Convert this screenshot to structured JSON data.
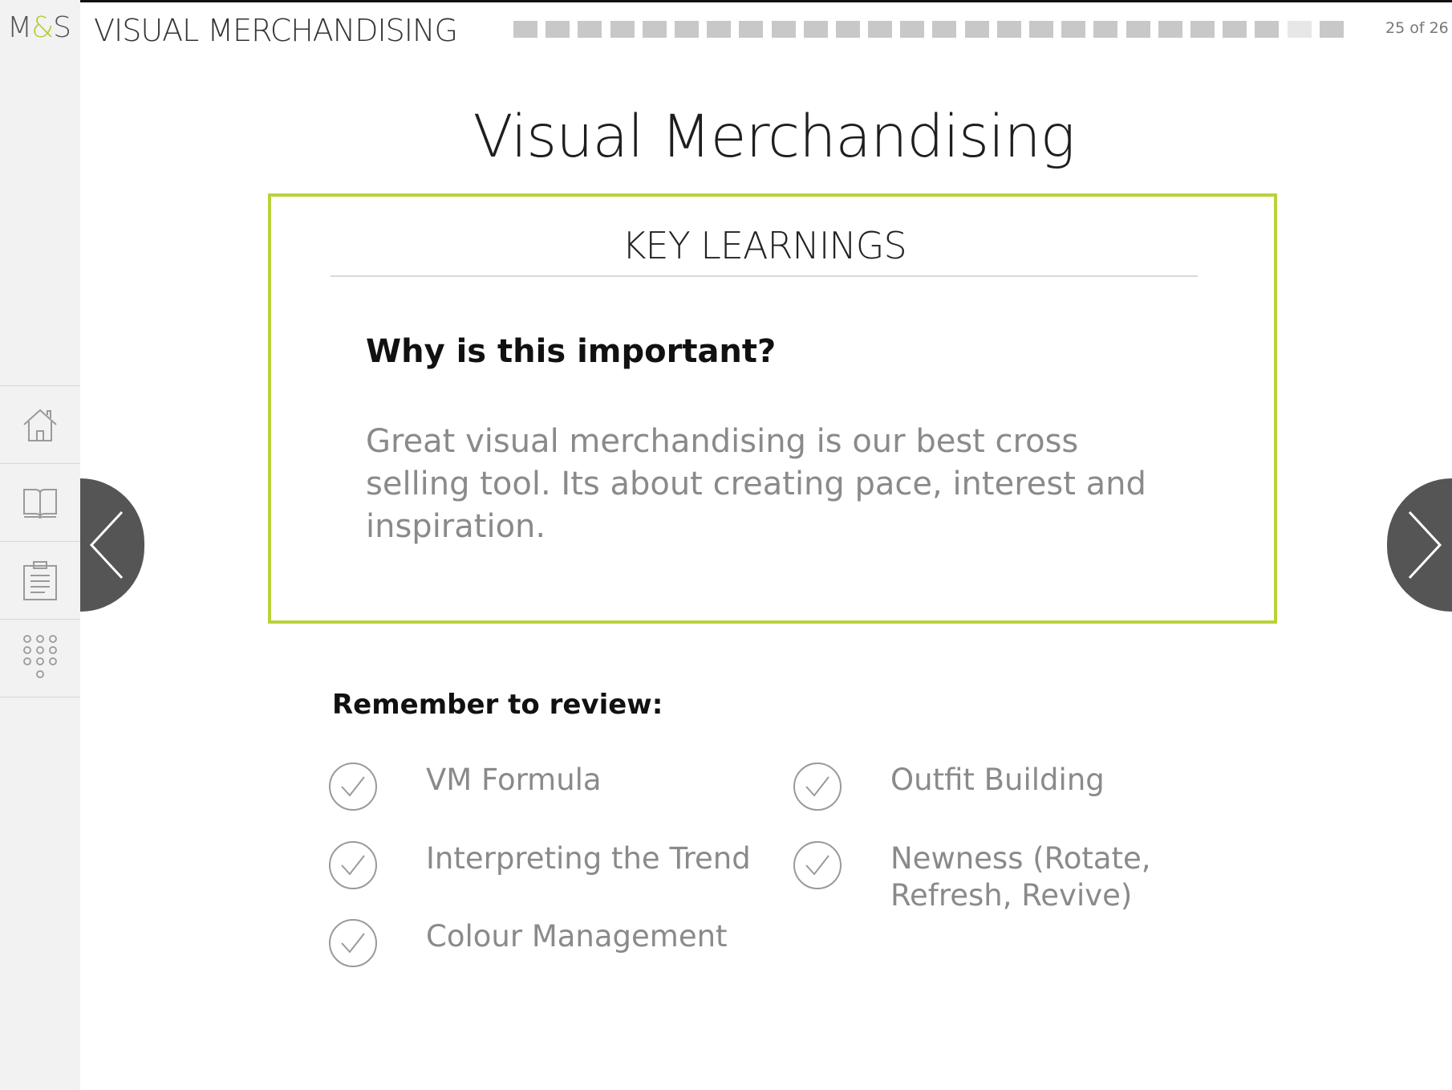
{
  "header": {
    "logo_left": "M",
    "logo_amp": "&",
    "logo_right": "S",
    "app_title": "VISUAL MERCHANDISING",
    "page_count": "25 of 26",
    "progress": {
      "current": 25,
      "total": 26
    }
  },
  "sidebar": {
    "items": [
      {
        "icon": "home-icon"
      },
      {
        "icon": "book-icon"
      },
      {
        "icon": "clipboard-icon"
      },
      {
        "icon": "grid-icon"
      }
    ]
  },
  "main": {
    "title": "Visual Merchandising",
    "key_box": {
      "heading": "KEY LEARNINGS",
      "question": "Why is this important?",
      "text": "Great visual merchandising is our best cross selling tool. Its about creating pace, interest and inspiration."
    },
    "review": {
      "title": "Remember to review:",
      "items": [
        "VM Formula",
        "Interpreting the Trend",
        "Colour Management",
        "Outfit Building",
        "Newness (Rotate, Refresh, Revive)"
      ]
    }
  },
  "colors": {
    "accent": "#b9d13a",
    "nav_button": "#555555",
    "sidebar_bg": "#f2f2f2"
  }
}
